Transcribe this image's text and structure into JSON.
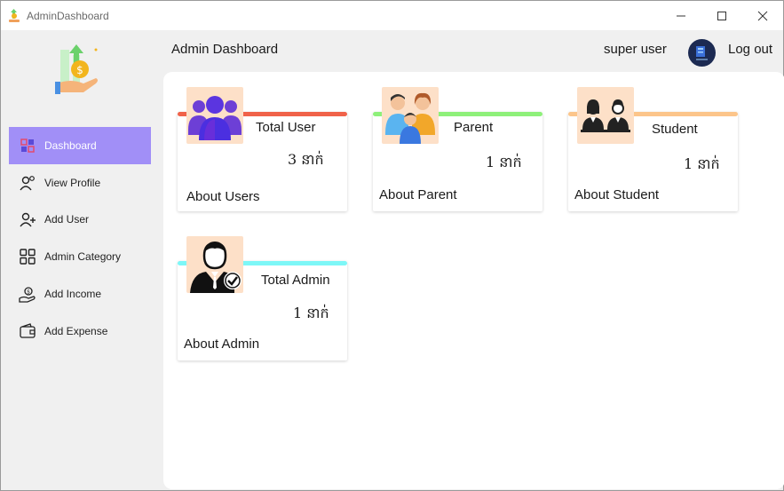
{
  "window": {
    "title": "AdminDashboard",
    "icon": "money-plant-icon"
  },
  "sidebar": {
    "items": [
      {
        "label": "Dashboard",
        "icon": "dashboard-icon",
        "active": true
      },
      {
        "label": "View Profile",
        "icon": "profile-icon",
        "active": false
      },
      {
        "label": "Add User",
        "icon": "add-user-icon",
        "active": false
      },
      {
        "label": "Admin Category",
        "icon": "category-grid-icon",
        "active": false
      },
      {
        "label": "Add Income",
        "icon": "income-icon",
        "active": false
      },
      {
        "label": "Add Expense",
        "icon": "wallet-icon",
        "active": false
      }
    ]
  },
  "header": {
    "title": "Admin Dashboard",
    "user_name": "super user",
    "logout_label": "Log out"
  },
  "cards": [
    {
      "title": "Total User",
      "count": "3 នាក់",
      "link": "About Users",
      "accent": "#f06249"
    },
    {
      "title": "Parent",
      "count": "1 នាក់",
      "link": "About Parent",
      "accent": "#8ef07a"
    },
    {
      "title": "Student",
      "count": "1 នាក់",
      "link": "About Student",
      "accent": "#fcc58a"
    },
    {
      "title": "Total Admin",
      "count": "1 នាក់",
      "link": "About Admin",
      "accent": "#7df7f7"
    }
  ],
  "colors": {
    "active_nav": "#a18ff7",
    "card_image_bg": "#fde0c8"
  }
}
